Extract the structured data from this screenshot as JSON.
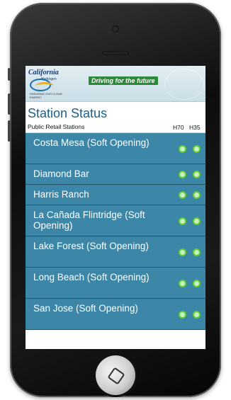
{
  "banner": {
    "logo_title": "California",
    "logo_subtitle": "Hydrogen",
    "logo_tag": "ENSURING OUR CLEAN ENERGY",
    "tagline": "Driving for the future"
  },
  "page_title": "Station Status",
  "table_header": {
    "label": "Public Retail Stations",
    "col1": "H70",
    "col2": "H35"
  },
  "stations": [
    {
      "name": "Costa Mesa (Soft Opening)",
      "h70": "available",
      "h35": "available"
    },
    {
      "name": "Diamond Bar",
      "h70": "available",
      "h35": "available"
    },
    {
      "name": "Harris Ranch",
      "h70": "available",
      "h35": "available"
    },
    {
      "name": "La Cañada Flintridge (Soft Opening)",
      "h70": "available",
      "h35": "available"
    },
    {
      "name": "Lake Forest (Soft Opening)",
      "h70": "available",
      "h35": "available"
    },
    {
      "name": "Long Beach (Soft Opening)",
      "h70": "available",
      "h35": "available"
    },
    {
      "name": "San Jose (Soft Opening)",
      "h70": "available",
      "h35": "available"
    }
  ],
  "colors": {
    "row_bg": "#3c86a8",
    "title": "#1e5f8a",
    "status_ok": "#5dcf36",
    "tagline_bg": "#2c8a3a"
  },
  "icons": {
    "status": "status-dot-icon",
    "home": "home-button-icon"
  }
}
